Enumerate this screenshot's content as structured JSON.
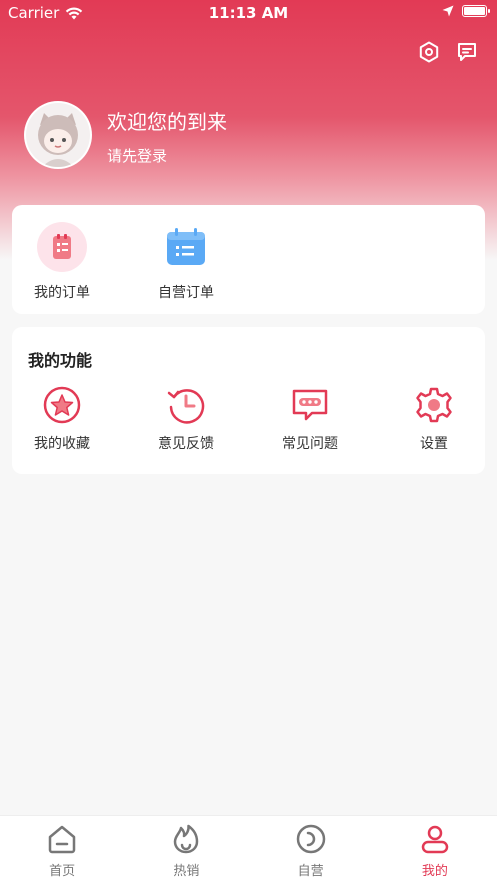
{
  "status_bar": {
    "carrier": "Carrier",
    "time": "11:13 AM"
  },
  "header": {
    "icons": [
      "settings-hex-icon",
      "message-icon"
    ]
  },
  "profile": {
    "welcome": "欢迎您的到来",
    "login_prompt": "请先登录"
  },
  "orders": {
    "items": [
      {
        "label": "我的订单",
        "icon": "order-list-icon"
      },
      {
        "label": "自营订单",
        "icon": "calendar-list-icon"
      }
    ]
  },
  "functions": {
    "title": "我的功能",
    "items": [
      {
        "label": "我的收藏",
        "icon": "star-icon"
      },
      {
        "label": "意见反馈",
        "icon": "history-clock-icon"
      },
      {
        "label": "常见问题",
        "icon": "chat-bubble-icon"
      },
      {
        "label": "设置",
        "icon": "gear-icon"
      }
    ]
  },
  "tabbar": {
    "items": [
      {
        "label": "首页",
        "icon": "home-icon"
      },
      {
        "label": "热销",
        "icon": "flame-icon"
      },
      {
        "label": "自营",
        "icon": "self-run-icon"
      },
      {
        "label": "我的",
        "icon": "user-icon"
      }
    ],
    "active_index": 3
  },
  "colors": {
    "accent": "#e23a55",
    "accent_light": "#f07a86",
    "blue": "#5aa9f5"
  }
}
